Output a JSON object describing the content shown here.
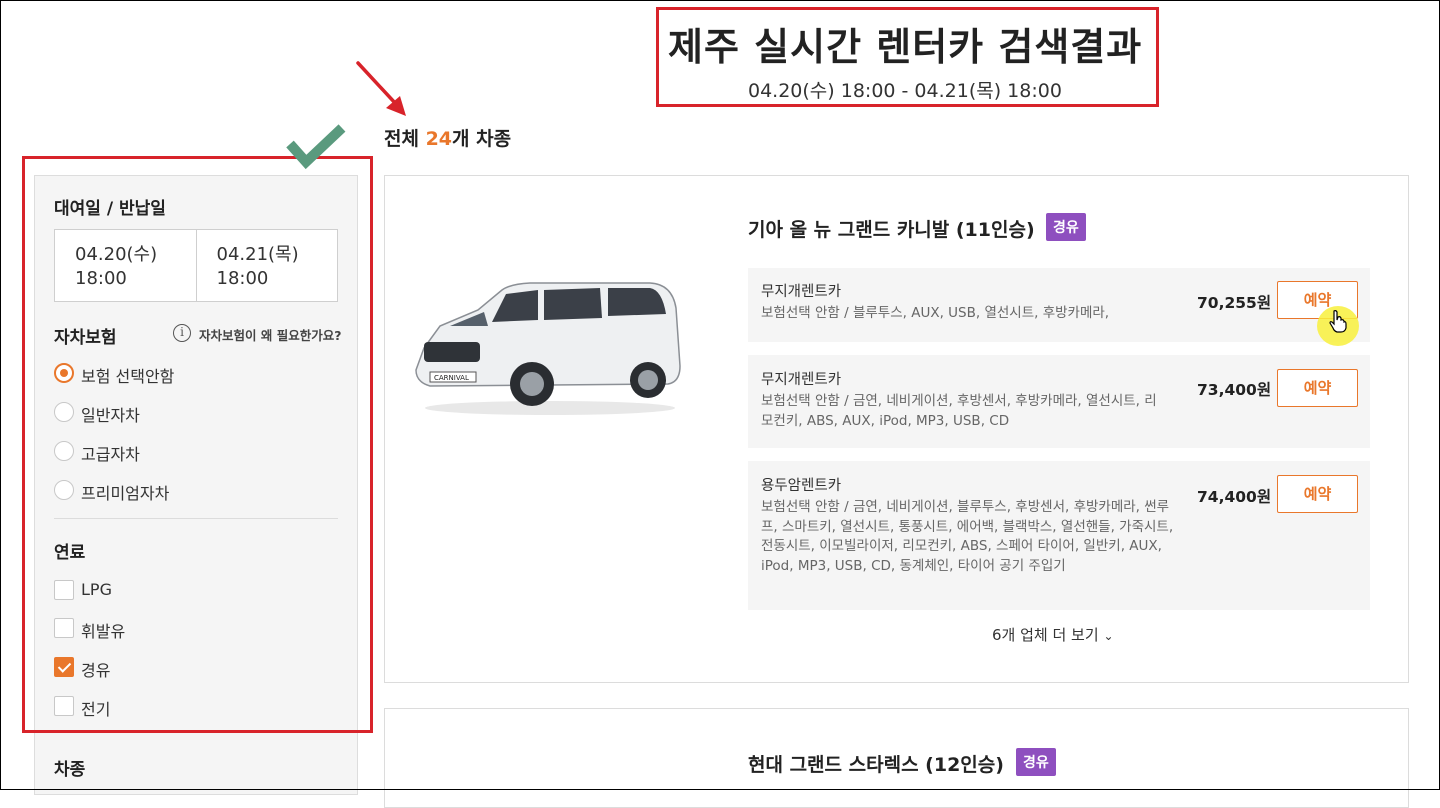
{
  "header": {
    "title": "제주 실시간 렌터카 검색결과",
    "date_range": "04.20(수) 18:00 - 04.21(목) 18:00",
    "total_prefix": "전체 ",
    "total_count": "24",
    "total_suffix": "개 차종"
  },
  "sidebar": {
    "rental_dates_title": "대여일 / 반납일",
    "pickup_date": "04.20(수)",
    "pickup_time": "18:00",
    "return_date": "04.21(목)",
    "return_time": "18:00",
    "insurance_title": "자차보험",
    "insurance_help": "자차보험이 왜 필요한가요?",
    "insurance_options": [
      {
        "label": "보험 선택안함",
        "selected": true
      },
      {
        "label": "일반자차",
        "selected": false
      },
      {
        "label": "고급자차",
        "selected": false
      },
      {
        "label": "프리미엄자차",
        "selected": false
      }
    ],
    "fuel_title": "연료",
    "fuel_options": [
      {
        "label": "LPG",
        "checked": false
      },
      {
        "label": "휘발유",
        "checked": false
      },
      {
        "label": "경유",
        "checked": true
      },
      {
        "label": "전기",
        "checked": false
      }
    ],
    "car_type_title": "차종"
  },
  "results": [
    {
      "car_name": "기아 올 뉴 그랜드 카니발 (11인승)",
      "fuel_badge": "경유",
      "image_label": "CARNIVAL",
      "offers": [
        {
          "company": "무지개렌트카",
          "options": "보험선택 안함 / 블루투스, AUX, USB, 열선시트, 후방카메라,",
          "price": "70,255원",
          "button": "예약"
        },
        {
          "company": "무지개렌트카",
          "options": "보험선택 안함 / 금연, 네비게이션, 후방센서, 후방카메라, 열선시트, 리모컨키, ABS, AUX, iPod, MP3, USB, CD",
          "price": "73,400원",
          "button": "예약"
        },
        {
          "company": "용두암렌트카",
          "options": "보험선택 안함 / 금연, 네비게이션, 블루투스, 후방센서, 후방카메라, 썬루프, 스마트키, 열선시트, 통풍시트, 에어백, 블랙박스, 열선핸들, 가죽시트, 전동시트, 이모빌라이저, 리모컨키, ABS, 스페어 타이어, 일반키, AUX, iPod, MP3, USB, CD, 동계체인, 타이어 공기 주입기",
          "price": "74,400원",
          "button": "예약"
        }
      ],
      "more_label": "6개 업체 더 보기"
    },
    {
      "car_name": "현대 그랜드 스타렉스 (12인승)",
      "fuel_badge": "경유"
    }
  ],
  "colors": {
    "accent": "#e9772b",
    "annotation_red": "#d8232a",
    "badge_purple": "#8e4fbf",
    "check_green": "#5a9a7e"
  }
}
